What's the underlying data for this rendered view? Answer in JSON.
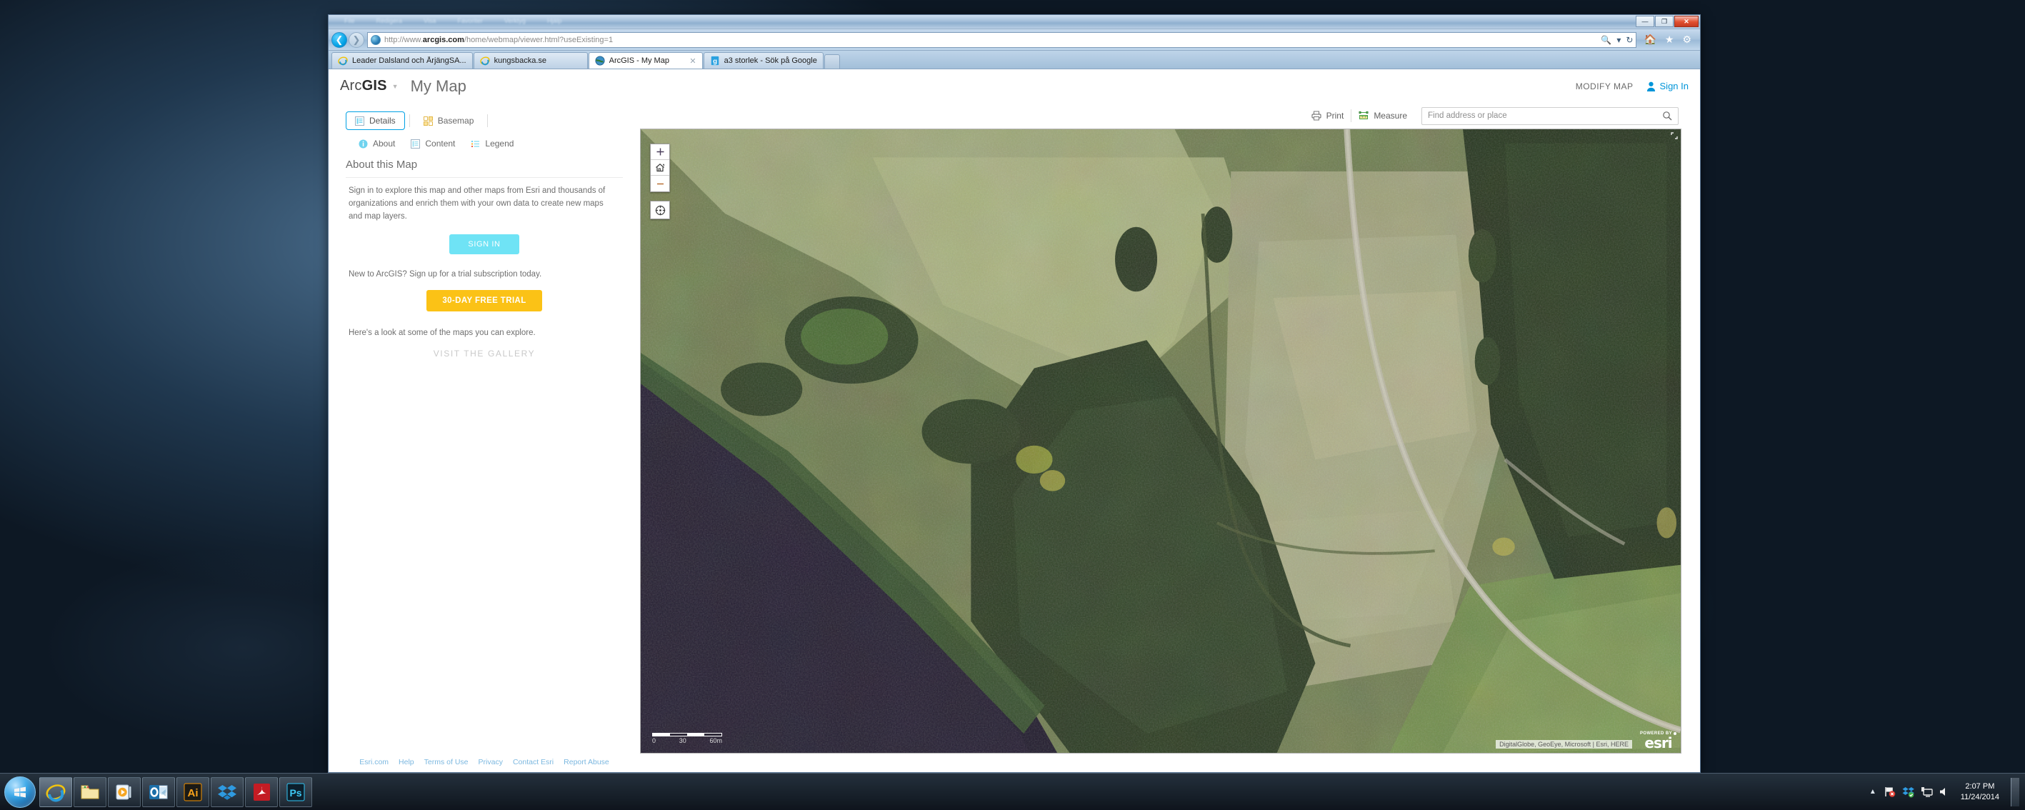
{
  "window": {
    "menu_items": [
      "File",
      "Redigera",
      "Visa",
      "Favoriter",
      "Verktyg",
      "Hjälp"
    ],
    "minimize_label": "—",
    "restore_label": "❐",
    "close_label": "✕"
  },
  "browser": {
    "back_icon": "back-arrow-icon",
    "forward_icon": "forward-arrow-icon",
    "url_prefix": "http://www.",
    "url_domain": "arcgis.com",
    "url_path": "/home/webmap/viewer.html?useExisting=1",
    "search_icon": "search-icon",
    "caret_icon": "chevron-down-icon",
    "refresh_icon": "refresh-icon",
    "home_icon": "home-icon",
    "favorites_icon": "star-icon",
    "settings_icon": "gear-icon",
    "tabs": [
      {
        "label": "Leader Dalsland och ÅrjängSA...",
        "active": false,
        "favicon": "ie-icon"
      },
      {
        "label": "kungsbacka.se",
        "active": false,
        "favicon": "ie-icon"
      },
      {
        "label": "ArcGIS - My Map",
        "active": true,
        "favicon": "arcgis-icon"
      },
      {
        "label": "a3 storlek - Sök på Google",
        "active": false,
        "favicon": "google-icon"
      }
    ],
    "new_tab_label": ""
  },
  "app": {
    "logo_arc": "Arc",
    "logo_gis": "GIS",
    "map_title": "My Map",
    "modify_map": "MODIFY MAP",
    "sign_in_top": "Sign In"
  },
  "panel": {
    "tabs": [
      {
        "label": "Details",
        "icon": "details-icon",
        "active": true
      },
      {
        "label": "Basemap",
        "icon": "basemap-icon",
        "active": false
      }
    ],
    "subtabs": [
      {
        "label": "About",
        "icon": "info-icon"
      },
      {
        "label": "Content",
        "icon": "content-icon"
      },
      {
        "label": "Legend",
        "icon": "legend-icon"
      }
    ],
    "about_title": "About this Map",
    "about_text": "Sign in to explore this map and other maps from Esri and thousands of organizations and enrich them with your own data to create new maps and map layers.",
    "sign_in_button": "SIGN IN",
    "trial_note": "New to ArcGIS? Sign up for a trial subscription today.",
    "trial_button": "30-DAY FREE TRIAL",
    "gallery_note": "Here's a look at some of the maps you can explore.",
    "gallery_button": "VISIT THE GALLERY"
  },
  "footer": {
    "links": [
      "Esri.com",
      "Help",
      "Terms of Use",
      "Privacy",
      "Contact Esri",
      "Report Abuse"
    ]
  },
  "map_toolbar": {
    "print_label": "Print",
    "print_icon": "printer-icon",
    "measure_label": "Measure",
    "measure_icon": "measure-icon",
    "search_placeholder": "Find address or place",
    "search_value": "",
    "search_icon": "search-icon"
  },
  "map": {
    "zoom_in_label": "+",
    "zoom_in_icon": "plus-icon",
    "home_icon": "home-icon",
    "zoom_out_label": "–",
    "zoom_out_icon": "minus-icon",
    "locate_icon": "locate-icon",
    "expand_icon": "expand-icon",
    "scale_labels": [
      "0",
      "30",
      "60m"
    ],
    "attribution": "DigitalGlobe, GeoEye, Microsoft | Esri, HERE",
    "esri_powered": "POWERED BY",
    "esri_word": "esri"
  },
  "taskbar": {
    "start_icon": "windows-start-icon",
    "items": [
      {
        "name": "internet-explorer",
        "icon": "ie-icon",
        "active": true
      },
      {
        "name": "file-explorer",
        "icon": "folder-icon",
        "active": false
      },
      {
        "name": "media-player",
        "icon": "media-player-icon",
        "active": false
      },
      {
        "name": "outlook",
        "icon": "outlook-icon",
        "active": false
      },
      {
        "name": "illustrator",
        "icon": "illustrator-icon",
        "active": false
      },
      {
        "name": "dropbox",
        "icon": "dropbox-icon",
        "active": false
      },
      {
        "name": "acrobat-reader",
        "icon": "acrobat-icon",
        "active": false
      },
      {
        "name": "photoshop",
        "icon": "photoshop-icon",
        "active": false
      }
    ],
    "tray_caret": "▲",
    "tray_icons": [
      "flag-alert-icon",
      "dropbox-tray-icon",
      "network-icon",
      "volume-icon"
    ],
    "time": "2:07 PM",
    "date": "11/24/2014"
  },
  "colors": {
    "accent": "#00a0e4",
    "signin_button": "#6fe3f5",
    "trial_button": "#fbc216",
    "link": "#7cb8e0"
  }
}
